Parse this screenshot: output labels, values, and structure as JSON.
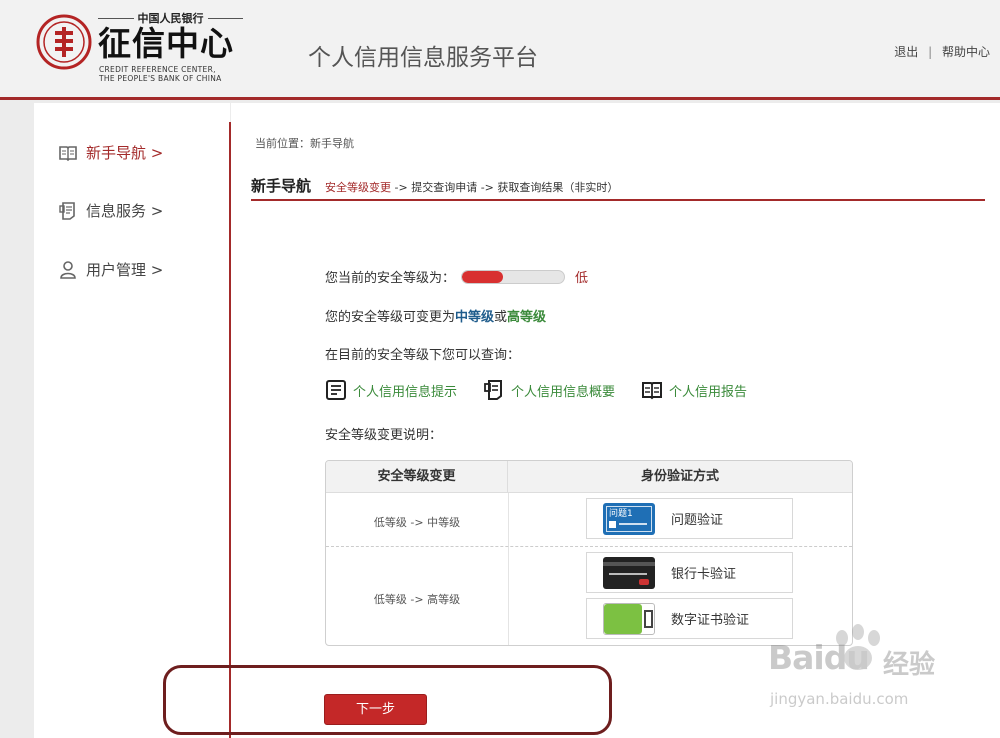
{
  "header": {
    "org_top": "中国人民银行",
    "org_name": "征信中心",
    "org_en_1": "CREDIT REFERENCE CENTER,",
    "org_en_2": "THE PEOPLE'S BANK OF CHINA",
    "platform_title": "个人信用信息服务平台",
    "logout": "退出",
    "separator": "|",
    "help": "帮助中心"
  },
  "sidebar": {
    "items": [
      {
        "label": "新手导航 >",
        "icon": "book-icon",
        "active": true
      },
      {
        "label": "信息服务 >",
        "icon": "document-icon",
        "active": false
      },
      {
        "label": "用户管理 >",
        "icon": "user-icon",
        "active": false
      }
    ]
  },
  "main": {
    "breadcrumb": "当前位置：新手导航",
    "section_title": "新手导航",
    "step_current": "安全等级变更",
    "step_rest": " -> 提交查询申请 -> 获取查询结果（非实时）",
    "security_label": "您当前的安全等级为：",
    "security_level": "低",
    "security_level_fraction": 0.4,
    "change_prefix": "您的安全等级可变更为 ",
    "change_mid": "中等级",
    "change_or": "或",
    "change_high": "高等级",
    "query_label": "在目前的安全等级下您可以查询：",
    "query_links": [
      {
        "label": "个人信用信息提示",
        "icon": "report-tip-icon"
      },
      {
        "label": "个人信用信息概要",
        "icon": "report-summary-icon"
      },
      {
        "label": "个人信用报告",
        "icon": "report-book-icon"
      }
    ],
    "explain_label": "安全等级变更说明：",
    "table": {
      "col1": "安全等级变更",
      "col2": "身份验证方式",
      "row1_change": "低等级 -> 中等级",
      "row2_change": "低等级 -> 高等级",
      "method_question": "问题验证",
      "method_question_badge": "问题1",
      "method_bankcard": "银行卡验证",
      "method_cert": "数字证书验证"
    },
    "next_button": "下一步"
  },
  "watermark": {
    "logo": "Baidu",
    "cn": "经验",
    "url": "jingyan.baidu.com"
  },
  "colors": {
    "brand_red": "#a32a2a",
    "button_red": "#c42828",
    "link_green": "#3a8a3a",
    "mid_blue": "#1f5c8c"
  }
}
